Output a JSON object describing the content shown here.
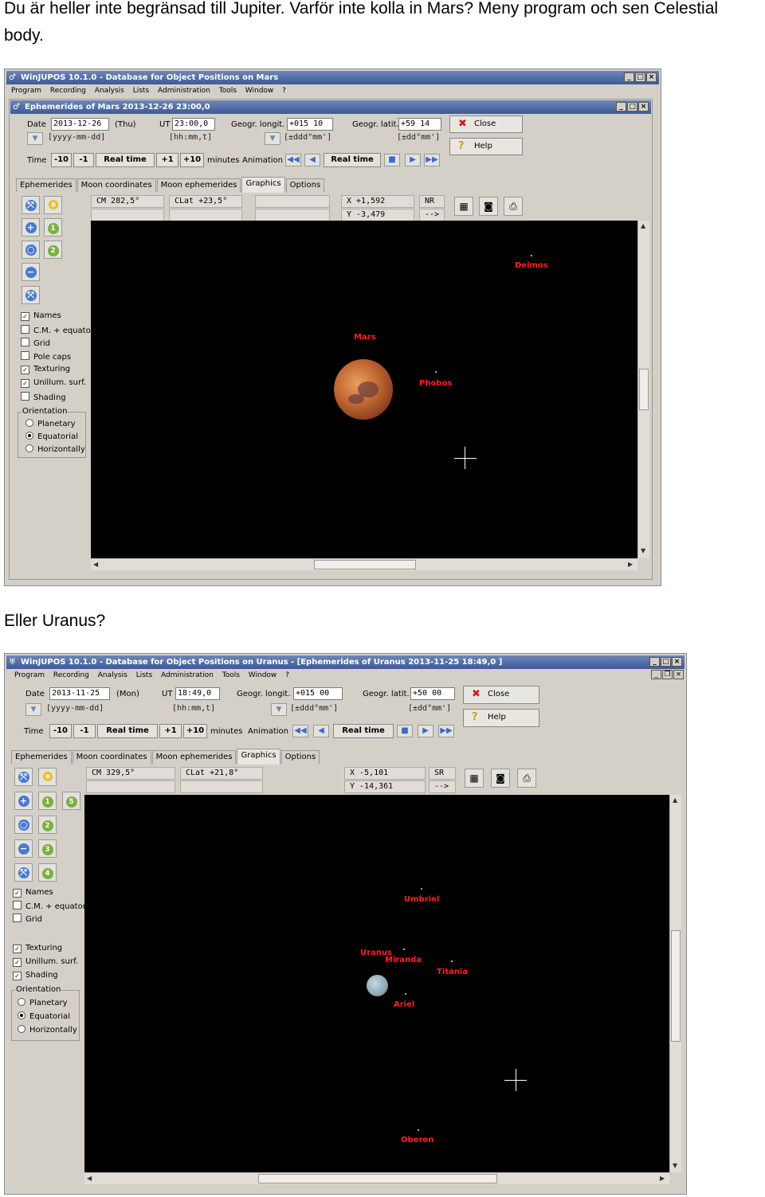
{
  "text1_line1": "Du är heller inte begränsad till Jupiter. Varför inte kolla in Mars? Meny program och sen Celestial",
  "text1_line2": "body.",
  "text2": "Eller Uranus?",
  "mars": {
    "title": "WinJUPOS 10.1.0 - Database for Object Positions on Mars",
    "menu": [
      "Program",
      "Recording",
      "Analysis",
      "Lists",
      "Administration",
      "Tools",
      "Window",
      "?"
    ],
    "subtitle": "Ephemerides of Mars  2013-12-26  23:00,0",
    "date_label": "Date",
    "date_value": "2013-12-26",
    "weekday": "(Thu)",
    "date_hint": "[yyyy-mm-dd]",
    "ut_label": "UT",
    "ut_value": "23:00,0",
    "ut_hint": "[hh:mm,t]",
    "long_label": "Geogr. longit.",
    "long_value": "+015 10",
    "long_hint": "[±ddd°mm']",
    "lat_label": "Geogr. latit.",
    "lat_value": "+59 14",
    "lat_hint": "[±dd°mm']",
    "close": "Close",
    "help": "Help",
    "time_label": "Time",
    "m10": "-10",
    "m1": "-1",
    "realtime": "Real time",
    "p1": "+1",
    "p10": "+10",
    "minutes": "minutes",
    "animation": "Animation",
    "anim_realtime": "Real time",
    "tabs": [
      "Ephemerides",
      "Moon coordinates",
      "Moon ephemerides",
      "Graphics",
      "Options"
    ],
    "cm": "CM   282,5°",
    "clat": "CLat +23,5°",
    "x": "X   +1,592",
    "y": "Y   -3,479",
    "nr": "NR",
    "arrow": "-->",
    "checks": [
      {
        "label": "Names",
        "on": true
      },
      {
        "label": "C.M. + equator",
        "on": false
      },
      {
        "label": "Grid",
        "on": false
      },
      {
        "label": "Pole caps",
        "on": false
      },
      {
        "label": "Texturing",
        "on": true
      },
      {
        "label": "Unillum. surf.",
        "on": true
      },
      {
        "label": "Shading",
        "on": false
      }
    ],
    "orientation": "Orientation",
    "radios": [
      {
        "label": "Planetary",
        "on": false
      },
      {
        "label": "Equatorial",
        "on": true
      },
      {
        "label": "Horizontally",
        "on": false
      }
    ],
    "bodies": {
      "deimos": "Deimos",
      "mars": "Mars",
      "phobos": "Phobos"
    }
  },
  "uranus": {
    "title": "WinJUPOS 10.1.0 - Database for Object Positions on Uranus - [Ephemerides of Uranus  2013-11-25  18:49,0 ]",
    "menu": [
      "Program",
      "Recording",
      "Analysis",
      "Lists",
      "Administration",
      "Tools",
      "Window",
      "?"
    ],
    "date_label": "Date",
    "date_value": "2013-11-25",
    "weekday": "(Mon)",
    "date_hint": "[yyyy-mm-dd]",
    "ut_label": "UT",
    "ut_value": "18:49,0",
    "ut_hint": "[hh:mm,t]",
    "long_label": "Geogr. longit.",
    "long_value": "+015 00",
    "long_hint": "[±ddd°mm']",
    "lat_label": "Geogr. latit.",
    "lat_value": "+50 00",
    "lat_hint": "[±dd°mm']",
    "close": "Close",
    "help": "Help",
    "time_label": "Time",
    "m10": "-10",
    "m1": "-1",
    "realtime": "Real time",
    "p1": "+1",
    "p10": "+10",
    "minutes": "minutes",
    "animation": "Animation",
    "anim_realtime": "Real time",
    "tabs": [
      "Ephemerides",
      "Moon coordinates",
      "Moon ephemerides",
      "Graphics",
      "Options"
    ],
    "cm": "CM   329,5°",
    "clat": "CLat +21,8°",
    "x": "X   -5,101",
    "y": "Y  -14,361",
    "sr": "SR",
    "arrow": "-->",
    "checks": [
      {
        "label": "Names",
        "on": true
      },
      {
        "label": "C.M. + equator",
        "on": false
      },
      {
        "label": "Grid",
        "on": false
      },
      {
        "label": "Texturing",
        "on": true
      },
      {
        "label": "Unillum. surf.",
        "on": true
      },
      {
        "label": "Shading",
        "on": true
      }
    ],
    "orientation": "Orientation",
    "radios": [
      {
        "label": "Planetary",
        "on": false
      },
      {
        "label": "Equatorial",
        "on": true
      },
      {
        "label": "Horizontally",
        "on": false
      }
    ],
    "bodies": {
      "umbriel": "Umbriel",
      "uranus": "Uranus",
      "miranda": "Miranda",
      "titania": "Titania",
      "ariel": "Ariel",
      "oberon": "Oberon"
    }
  }
}
